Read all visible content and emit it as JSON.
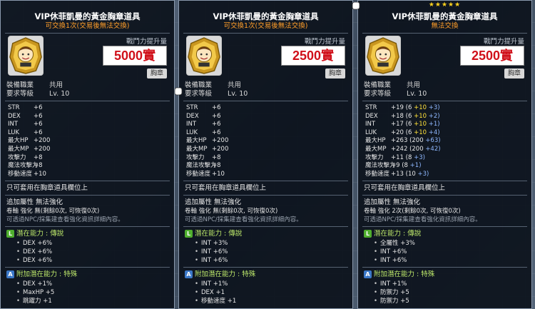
{
  "panels": [
    {
      "stars": "",
      "title": "VIP休菲凱曼的黃金胸章道具",
      "tradable": "可交換1次(交易後無法交換)",
      "stat_label": "戰鬥力提升量",
      "price": "5000實",
      "badge": "胸章",
      "req_job_label": "裝備職業",
      "req_job": "共用",
      "req_level_label": "要求等級",
      "req_level": "Lv. 10",
      "stats": [
        {
          "k": "STR",
          "v": "+6",
          "detail": ""
        },
        {
          "k": "DEX",
          "v": "+6",
          "detail": ""
        },
        {
          "k": "INT",
          "v": "+6",
          "detail": ""
        },
        {
          "k": "LUK",
          "v": "+6",
          "detail": ""
        },
        {
          "k": "最大HP",
          "v": "+200",
          "detail": ""
        },
        {
          "k": "最大MP",
          "v": "+200",
          "detail": ""
        },
        {
          "k": "攻擊力",
          "v": "+8",
          "detail": ""
        },
        {
          "k": "魔法攻擊力",
          "v": "+8",
          "detail": ""
        },
        {
          "k": "移動速度",
          "v": "+10",
          "detail": ""
        }
      ],
      "slot_note": "只可套用在胸章道具欄位上",
      "extra_attr": "追加屬性  無法強化",
      "scroll": "卷軸 強化 無(剩餘0次, 可恢復0次)",
      "npc_note": "可透過NPC/採集建查看強化資訊詳細內容。",
      "potential_title": "潛在能力 : 傳說",
      "potential": [
        "DEX +6%",
        "DEX +6%",
        "DEX +6%"
      ],
      "additional_title": "附加潛在能力 : 特殊",
      "additional": [
        "DEX +1%",
        "MaxHP +5",
        "跳躍力 +1"
      ]
    },
    {
      "stars": "",
      "title": "VIP休菲凱曼的黃金胸章道具",
      "tradable": "可交換1次(交易後無法交換)",
      "stat_label": "戰鬥力提升量",
      "price": "2500實",
      "badge": "胸章",
      "req_job_label": "裝備職業",
      "req_job": "共用",
      "req_level_label": "要求等級",
      "req_level": "Lv. 10",
      "stats": [
        {
          "k": "STR",
          "v": "+6",
          "detail": ""
        },
        {
          "k": "DEX",
          "v": "+6",
          "detail": ""
        },
        {
          "k": "INT",
          "v": "+6",
          "detail": ""
        },
        {
          "k": "LUK",
          "v": "+6",
          "detail": ""
        },
        {
          "k": "最大HP",
          "v": "+200",
          "detail": ""
        },
        {
          "k": "最大MP",
          "v": "+200",
          "detail": ""
        },
        {
          "k": "攻擊力",
          "v": "+8",
          "detail": ""
        },
        {
          "k": "魔法攻擊力",
          "v": "+8",
          "detail": ""
        },
        {
          "k": "移動速度",
          "v": "+10",
          "detail": ""
        }
      ],
      "slot_note": "只可套用在胸章道具欄位上",
      "extra_attr": "追加屬性  無法強化",
      "scroll": "卷軸 強化 無(剩餘0次, 可恢復0次)",
      "npc_note": "可透過NPC/採集建查看強化資訊詳細內容。",
      "potential_title": "潛在能力 : 傳說",
      "potential": [
        "INT +3%",
        "INT +6%",
        "INT +6%"
      ],
      "additional_title": "附加潛在能力 : 特殊",
      "additional": [
        "INT +1%",
        "DEX +1",
        "移動速度 +1"
      ]
    },
    {
      "stars": "★★★★★",
      "title": "VIP休菲凱曼的黃金胸章道具",
      "tradable": "無法交換",
      "stat_label": "戰鬥力提升量",
      "price": "2500實",
      "badge": "胸章",
      "req_job_label": "裝備職業",
      "req_job": "共用",
      "req_level_label": "要求等級",
      "req_level": "Lv. 10",
      "stats": [
        {
          "k": "STR",
          "v": "+19",
          "d1": "(6 ",
          "d2": "+10",
          "d3": " +3)"
        },
        {
          "k": "DEX",
          "v": "+18",
          "d1": "(6 ",
          "d2": "+10",
          "d3": " +2)"
        },
        {
          "k": "INT",
          "v": "+17",
          "d1": "(6 ",
          "d2": "+10",
          "d3": " +1)"
        },
        {
          "k": "LUK",
          "v": "+20",
          "d1": "(6 ",
          "d2": "+10",
          "d3": " +4)"
        },
        {
          "k": "最大HP",
          "v": "+263",
          "d1": "(200 ",
          "d2": "",
          "d3": "+63)"
        },
        {
          "k": "最大MP",
          "v": "+242",
          "d1": "(200 ",
          "d2": "",
          "d3": "+42)"
        },
        {
          "k": "攻擊力",
          "v": "+11",
          "d1": "(8 ",
          "d2": "",
          "d3": "+3)"
        },
        {
          "k": "魔法攻擊力",
          "v": "+9",
          "d1": "(8 ",
          "d2": "",
          "d3": "+1)"
        },
        {
          "k": "移動速度",
          "v": "+13",
          "d1": "(10 ",
          "d2": "",
          "d3": "+3)"
        }
      ],
      "slot_note": "只可套用在胸章道具欄位上",
      "extra_attr": "追加屬性  無法強化",
      "scroll": "卷軸 強化 2次(剩餘0次, 可恢復0次)",
      "npc_note": "可透過NPC/採集建查看強化資訊詳細內容。",
      "potential_title": "潛在能力 : 傳說",
      "potential": [
        "全屬性 +3%",
        "INT +6%",
        "INT +6%"
      ],
      "additional_title": "附加潛在能力 : 特殊",
      "additional": [
        "INT +1%",
        "防禦力 +5",
        "防禦力 +5"
      ]
    }
  ]
}
